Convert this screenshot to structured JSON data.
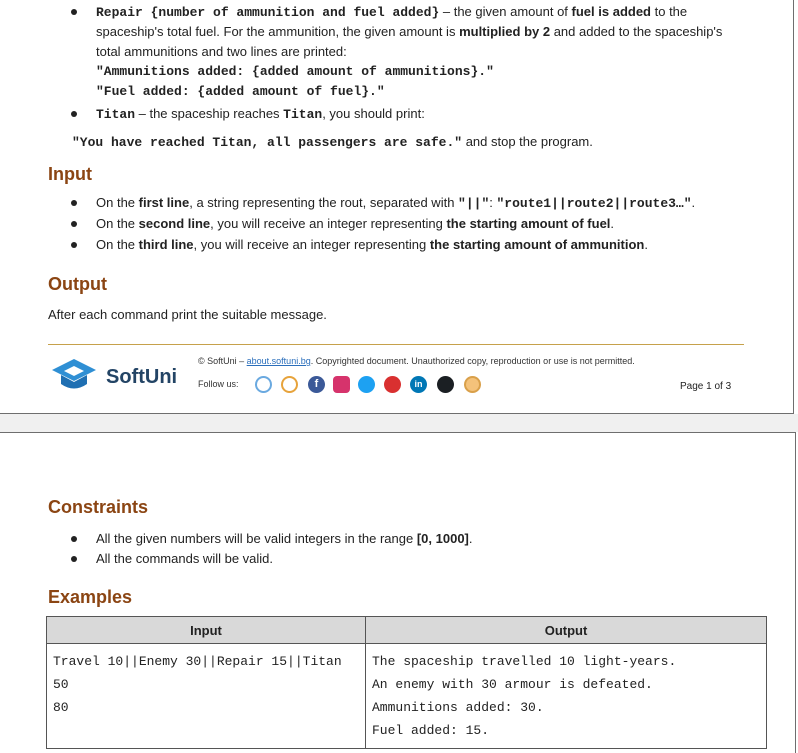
{
  "p1": {
    "repair_cmd": "Repair {number of ammunition and fuel added}",
    "repair_t1": " – the given amount of ",
    "repair_b1": "fuel is added",
    "repair_t2": " to the",
    "repair_l2": "spaceship's total fuel. For the ammunition, the given amount is ",
    "repair_b2": "multiplied by 2",
    "repair_t3": " and added to the spaceship's",
    "repair_l3": "total ammunitions and two lines are printed:",
    "repair_out1": "\"Ammunitions added: {added amount of ammunitions}.\"",
    "repair_out2": "\"Fuel added: {added amount of fuel}.\"",
    "titan_cmd": "Titan",
    "titan_t1": " – the spaceship reaches ",
    "titan_b1": "Titan",
    "titan_t2": ", you should print:",
    "titan_out": "\"You have reached Titan, all passengers are safe.\"",
    "titan_t3": " and stop the program.",
    "input_heading": "Input",
    "in1_a": "On the ",
    "in1_b": "first line",
    "in1_c": ", a string representing the rout, separated with ",
    "in1_code": "\"||\"",
    "in1_d": ": ",
    "in1_code2": "\"route1||route2||route3…\"",
    "in1_e": ".",
    "in2_a": "On the ",
    "in2_b": "second line",
    "in2_c": ", you will receive an integer representing ",
    "in2_d": "the starting amount of fuel",
    "in2_e": ".",
    "in3_a": "On the ",
    "in3_b": "third line",
    "in3_c": ", you will receive an integer representing ",
    "in3_d": "the starting amount of ammunition",
    "in3_e": ".",
    "output_heading": "Output",
    "output_text": "After each command print the suitable message."
  },
  "footer": {
    "brand": "SoftUni",
    "copy_a": "© SoftUni – ",
    "copy_link": "about.softuni.bg",
    "copy_b": ". Copyrighted document. Unauthorized copy, reproduction or use is not permitted.",
    "follow": "Follow us:",
    "page": "Page 1 of 3",
    "social_icons": [
      "softuni-icon",
      "softuni-foundation-icon",
      "facebook-icon",
      "instagram-icon",
      "twitter-icon",
      "youtube-icon",
      "linkedin-icon",
      "github-icon",
      "email-icon"
    ]
  },
  "p2": {
    "constraints_heading": "Constraints",
    "c1_a": "All the given numbers will be valid integers in the range ",
    "c1_b": "[0, 1000]",
    "c1_c": ".",
    "c2": "All the commands will be valid.",
    "examples_heading": "Examples",
    "table": {
      "col_input": "Input",
      "col_output": "Output",
      "input_lines": [
        "Travel 10||Enemy 30||Repair 15||Titan",
        "50",
        "80"
      ],
      "output_lines": [
        "The spaceship travelled 10 light-years.",
        "An enemy with 30 armour is defeated.",
        "Ammunitions added: 30.",
        "Fuel added: 15."
      ]
    }
  },
  "colors": {
    "heading": "#8b4513",
    "brand": "#234465",
    "link": "#2a6ebb",
    "rule": "#c6a14b"
  }
}
